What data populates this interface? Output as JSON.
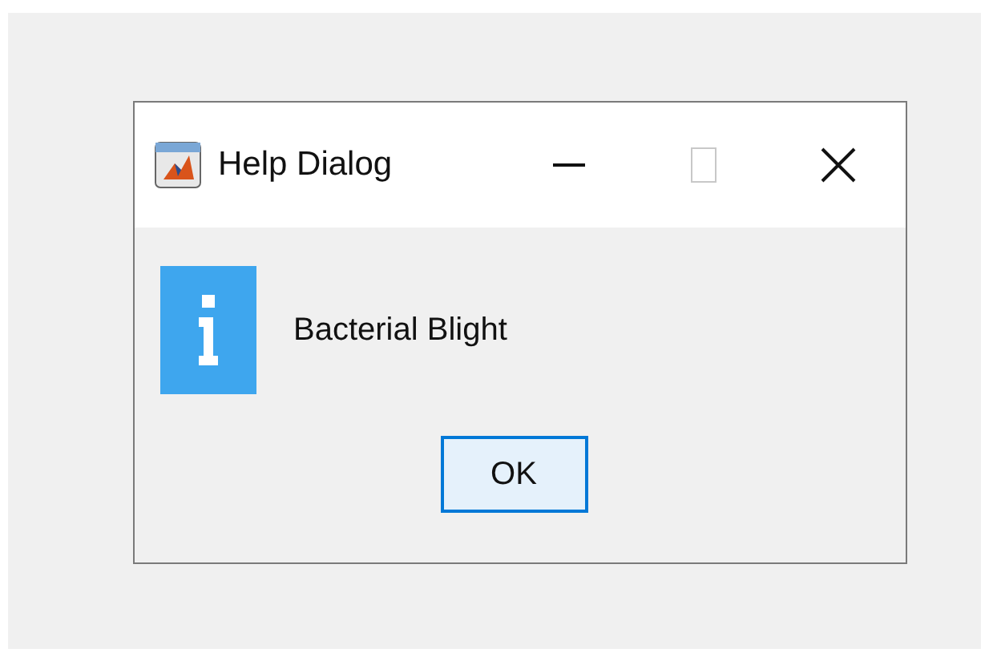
{
  "window": {
    "title": "Help Dialog",
    "controls": [
      {
        "kind": "minimize",
        "disabled": false
      },
      {
        "kind": "maximize",
        "disabled": true
      },
      {
        "kind": "close",
        "disabled": false
      }
    ]
  },
  "message": "Bacterial Blight",
  "buttons": [
    {
      "label": "OK",
      "focused": true
    }
  ]
}
